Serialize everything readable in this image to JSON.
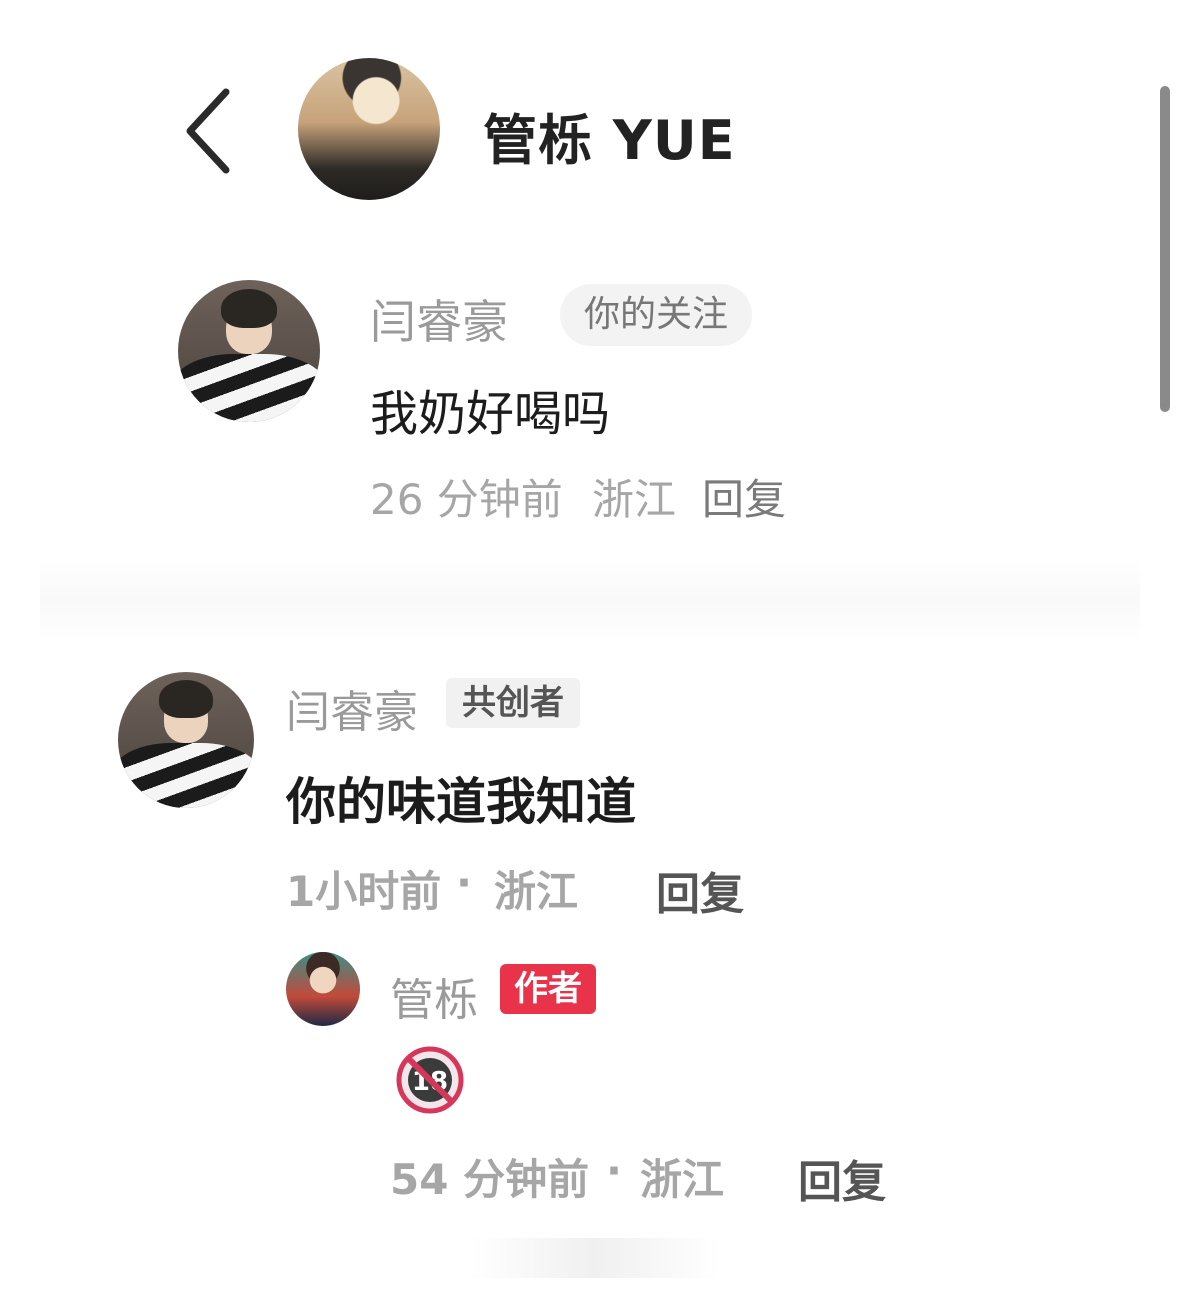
{
  "header": {
    "back_icon": "chevron-left-icon",
    "title": "管栎 YUE"
  },
  "comments": [
    {
      "username": "闫睿豪",
      "tag": "你的关注",
      "text": "我奶好喝吗",
      "time": "26 分钟前",
      "location": "浙江",
      "reply_label": "回复"
    },
    {
      "username": "闫睿豪",
      "tag": "共创者",
      "text": "你的味道我知道",
      "time": "1小时前",
      "location": "浙江",
      "reply_label": "回复",
      "replies": [
        {
          "username": "管栎",
          "tag": "作者",
          "sticker_icon": "no-18-sticker-icon",
          "time": "54 分钟前",
          "location": "浙江",
          "reply_label": "回复"
        }
      ]
    }
  ],
  "colors": {
    "author_tag": "#e8334a",
    "meta_text": "#a6a6a6"
  }
}
